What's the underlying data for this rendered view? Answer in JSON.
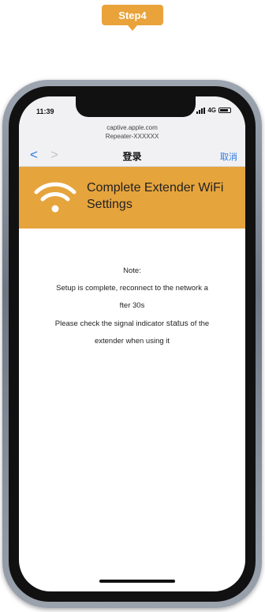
{
  "step_badge": {
    "label": "Step4"
  },
  "status_bar": {
    "time": "11:39",
    "network": "4G"
  },
  "url_bar": {
    "domain": "captive.apple.com",
    "ssid": "Repeater-XXXXXX"
  },
  "nav": {
    "back": "<",
    "forward": ">",
    "title": "登录",
    "cancel": "取消"
  },
  "banner": {
    "title": "Complete Extender WiFi Settings",
    "icon": "wifi-icon"
  },
  "note": {
    "heading": "Note:",
    "line1": "Setup is complete, reconnect to the network a",
    "line2": "fter 30s",
    "line3_pre": "Please check the signal indicator ",
    "line3_status": "status",
    "line3_post": " of the",
    "line4": "extender when using it"
  },
  "colors": {
    "accent": "#e6a43c",
    "link": "#2f7ae5"
  }
}
